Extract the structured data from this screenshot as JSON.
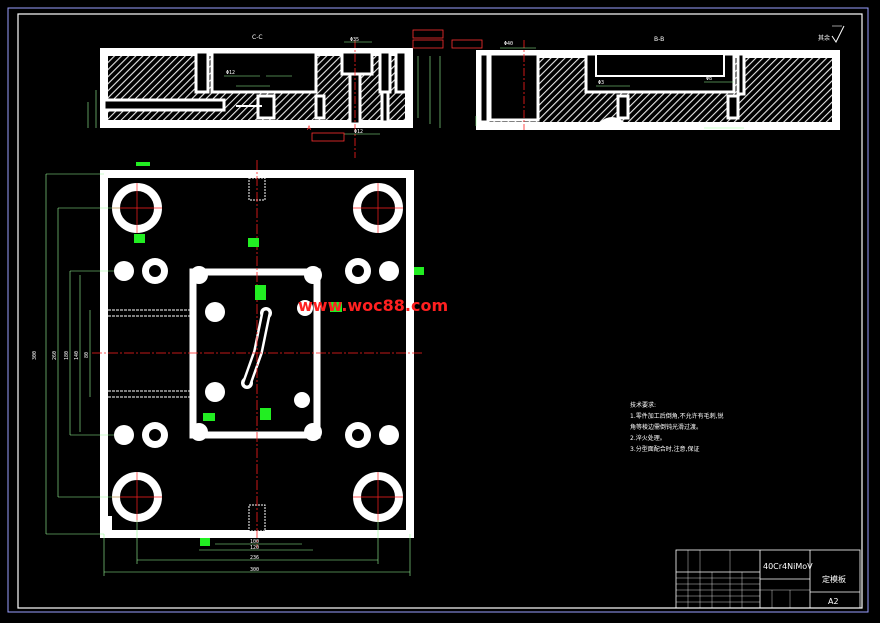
{
  "watermark": "www.woc88.com",
  "section_labels": {
    "left": "C-C",
    "right": "B-B"
  },
  "roughness_note": "其余",
  "technical_requirements": {
    "title": "技术要求:",
    "lines": [
      "1.零件加工后倒角,不允许有毛刺,锐",
      "角等棱边需倒钝光滑过渡。",
      "2.淬火处理。",
      "3.分型面配合时,注意,保证"
    ]
  },
  "title_block": {
    "material": "40Cr4NiMoV",
    "part_name": "定模板",
    "sheet_size": "A2"
  },
  "dimensions": {
    "width_total": "300",
    "width_inner": "236",
    "width_cavity": "120",
    "width_cavity2": "100",
    "height_total": "300",
    "height_2": "260",
    "height_3": "180",
    "height_4": "140",
    "height_5": "80",
    "phi_35": "Φ35",
    "phi_12": "Φ12",
    "phi_3": "Φ3",
    "phi_40": "Φ40",
    "phi_8": "Φ8"
  },
  "colors": {
    "background": "#000000",
    "outline": "#ffffff",
    "dimension": "#00ff00",
    "centerline": "#ff2020",
    "section_marker": "#ff3030",
    "hatch": "#ffffff"
  }
}
